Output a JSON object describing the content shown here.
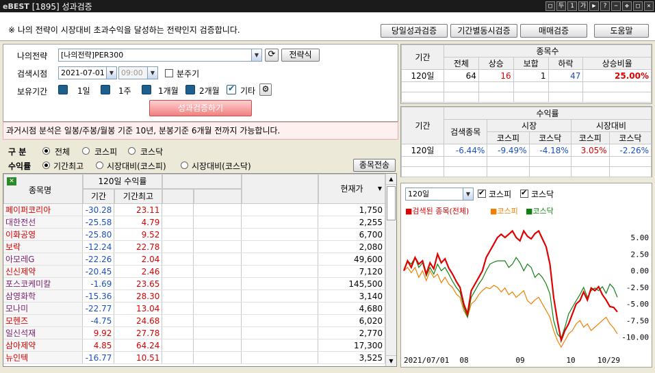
{
  "window": {
    "brand": "eBEST",
    "title": "[1895] 성과검증",
    "buttons": [
      "□",
      "두",
      "1",
      "가",
      "▶",
      "?",
      "−",
      "✥",
      "□",
      "✕"
    ]
  },
  "top": {
    "notice": "※ 나의 전략이 시장대비 초과수익을 달성하는 전략인지 검증합니다.",
    "btn_daily": "당일성과검증",
    "btn_period": "기간별동시검증",
    "btn_trade": "매매검증",
    "btn_help": "도움말"
  },
  "form": {
    "strategy_label": "나의전략",
    "strategy_value": "[나의전략]PER300",
    "formula_btn": "전략식",
    "search_label": "검색시점",
    "date": "2021-07-01",
    "time": "09:00",
    "minute_label": "분주기",
    "hold_label": "보유기간",
    "hold": [
      "1일",
      "1주",
      "1개월",
      "2개월",
      "기타"
    ],
    "run_btn": "성과검증하기"
  },
  "info": "과거시점 분석은 일봉/주봉/월봉 기준 10년, 분봉기준 6개월 전까지 가능합니다.",
  "filters": {
    "div_label": "구 분",
    "div_opts": [
      "전체",
      "코스피",
      "코스닥"
    ],
    "ret_label": "수익률",
    "ret_opts": [
      "기간최고",
      "시장대비(코스피)",
      "시장대비(코스닥)"
    ],
    "send_btn": "종목전송"
  },
  "grid": {
    "h_name": "종목명",
    "h_ret": "120일 수익률",
    "h_period": "기간",
    "h_max": "기간최고",
    "h_price": "현재가",
    "rows": [
      [
        "페이퍼코리아",
        "-30.28",
        "23.11",
        "1,750",
        "red"
      ],
      [
        "대한전선",
        "-25.58",
        "4.79",
        "2,255",
        "purple"
      ],
      [
        "이화공영",
        "-25.80",
        "9.52",
        "6,700",
        "red"
      ],
      [
        "보락",
        "-12.24",
        "22.78",
        "2,080",
        "red"
      ],
      [
        "아모레G",
        "-22.26",
        "2.04",
        "49,600",
        "purple"
      ],
      [
        "신신제약",
        "-20.45",
        "2.46",
        "7,120",
        "red"
      ],
      [
        "포스코케미칼",
        "-1.69",
        "23.65",
        "145,500",
        "purple"
      ],
      [
        "삼영화학",
        "-15.36",
        "28.30",
        "3,140",
        "purple"
      ],
      [
        "모나미",
        "-22.77",
        "13.04",
        "4,680",
        "purple"
      ],
      [
        "모헨즈",
        "-4.75",
        "24.68",
        "6,020",
        "red"
      ],
      [
        "일신석재",
        "9.92",
        "27.78",
        "2,770",
        "purple"
      ],
      [
        "삼아제약",
        "4.85",
        "64.24",
        "17,300",
        "red"
      ],
      [
        "뉴인텍",
        "-16.77",
        "10.51",
        "3,525",
        "red"
      ]
    ]
  },
  "stats": {
    "h_period": "기간",
    "h_count": "종목수",
    "h_total": "전체",
    "h_up": "상승",
    "h_flat": "보합",
    "h_down": "하락",
    "h_ratio": "상승비율",
    "period": "120일",
    "total": "64",
    "up": "16",
    "flat": "1",
    "down": "47",
    "ratio": "25.00%"
  },
  "returns": {
    "h_period": "기간",
    "h_ret": "수익률",
    "h_search": "검색종목",
    "h_market": "시장",
    "h_vs": "시장대비",
    "h_kospi": "코스피",
    "h_kosdaq": "코스닥",
    "period": "120일",
    "search": "-6.44%",
    "m_kospi": "-9.49%",
    "m_kosdaq": "-4.18%",
    "v_kospi": "3.05%",
    "v_kosdaq": "-2.26%"
  },
  "chart_panel": {
    "period": "120일",
    "cb_kospi": "코스피",
    "cb_kosdaq": "코스닥"
  },
  "chart_data": {
    "type": "line",
    "legend": [
      "■검색된 종목(전체)",
      "■코스피",
      "■코스닥"
    ],
    "colors": [
      "#e00000",
      "#f08000",
      "#108010"
    ],
    "x_labels": [
      "2021/07/01",
      "08",
      "09",
      "10",
      "10/29"
    ],
    "y_ticks": [
      "5.00",
      "2.50",
      "0.00",
      "-2.50",
      "-5.00",
      "-7.50",
      "-10.00"
    ],
    "ylim": [
      -12,
      8
    ],
    "series": [
      {
        "name": "검색된 종목(전체)",
        "values": [
          0,
          1.5,
          0.5,
          2.0,
          1.0,
          1.5,
          -0.5,
          1.2,
          0.3,
          2.5,
          1.2,
          1.8,
          0.4,
          -0.5,
          -1.6,
          -2.5,
          -5,
          -6.5,
          -3,
          -2,
          -1,
          0,
          2,
          3,
          4,
          5,
          5.5,
          5,
          5.5,
          6,
          5,
          4.5,
          6,
          5.2,
          4.8,
          5.6,
          6,
          4.8,
          3.6,
          1,
          -4,
          -7.5,
          -10.5,
          -9,
          -8,
          -6.5,
          -5,
          -4.5,
          -3.2,
          -4.4,
          -2.6,
          -3,
          -2.4,
          -3.6,
          -4.4,
          -5.4,
          -5.5,
          -6.2
        ]
      },
      {
        "name": "코스피",
        "values": [
          0,
          0.5,
          -0.3,
          0.5,
          -1.0,
          0,
          -1.5,
          0,
          -1,
          -0.5,
          -1.8,
          -1,
          -2,
          -2.5,
          -3.5,
          -4,
          -6,
          -7,
          -5,
          -4.5,
          -3.6,
          -3,
          -2.5,
          -2.7,
          -2.2,
          -2.5,
          -3.2,
          -2.6,
          -3.6,
          -3.2,
          -4,
          -3.5,
          -3,
          -4.5,
          -5,
          -4.4,
          -4,
          -5,
          -6,
          -7,
          -9,
          -10.5,
          -11.5,
          -10.5,
          -9.5,
          -9,
          -8,
          -7.5,
          -8.5,
          -8,
          -9,
          -8.5,
          -8,
          -7.5,
          -7,
          -8,
          -8.6,
          -9.5
        ]
      },
      {
        "name": "코스닥",
        "values": [
          0,
          1.5,
          1,
          2,
          0.5,
          1.2,
          -0.8,
          0.5,
          -0.5,
          1,
          0,
          0.5,
          -0.5,
          -1.6,
          -2.5,
          -3.2,
          -5.5,
          -7,
          -4,
          -3,
          -2,
          -1.2,
          0,
          1,
          1.3,
          1.5,
          1.5,
          1.5,
          0.5,
          1,
          2,
          1.2,
          0,
          1,
          0.5,
          -1,
          -0.4,
          -1,
          -2,
          -3.5,
          -7.5,
          -9.5,
          -10.2,
          -8.5,
          -6.5,
          -5.5,
          -4.5,
          -3.6,
          -2.5,
          -4,
          -3,
          -2.6,
          -3,
          -2.4,
          -3.4,
          -2,
          -2.6,
          -4
        ]
      }
    ]
  }
}
